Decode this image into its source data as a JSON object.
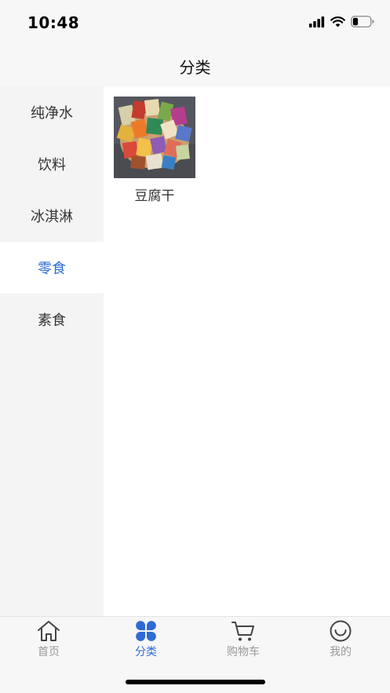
{
  "status_bar": {
    "time": "10:48",
    "icons": [
      "signal-icon",
      "wifi-icon",
      "battery-icon"
    ],
    "battery_level": 0.3
  },
  "nav": {
    "title": "分类"
  },
  "sidebar": {
    "items": [
      {
        "label": "纯净水",
        "active": false
      },
      {
        "label": "饮料",
        "active": false
      },
      {
        "label": "冰淇淋",
        "active": false
      },
      {
        "label": "零食",
        "active": true
      },
      {
        "label": "素食",
        "active": false
      }
    ]
  },
  "content": {
    "products": [
      {
        "name": "豆腐干",
        "thumb": "snack-pile-photo"
      }
    ]
  },
  "tab_bar": {
    "tabs": [
      {
        "label": "首页",
        "icon": "home-icon",
        "active": false
      },
      {
        "label": "分类",
        "icon": "category-icon",
        "active": true
      },
      {
        "label": "购物车",
        "icon": "cart-icon",
        "active": false
      },
      {
        "label": "我的",
        "icon": "smile-icon",
        "active": false
      }
    ]
  },
  "colors": {
    "accent": "#2f6bd3",
    "inactive": "#999999",
    "sidebar_bg": "#f4f4f4"
  }
}
